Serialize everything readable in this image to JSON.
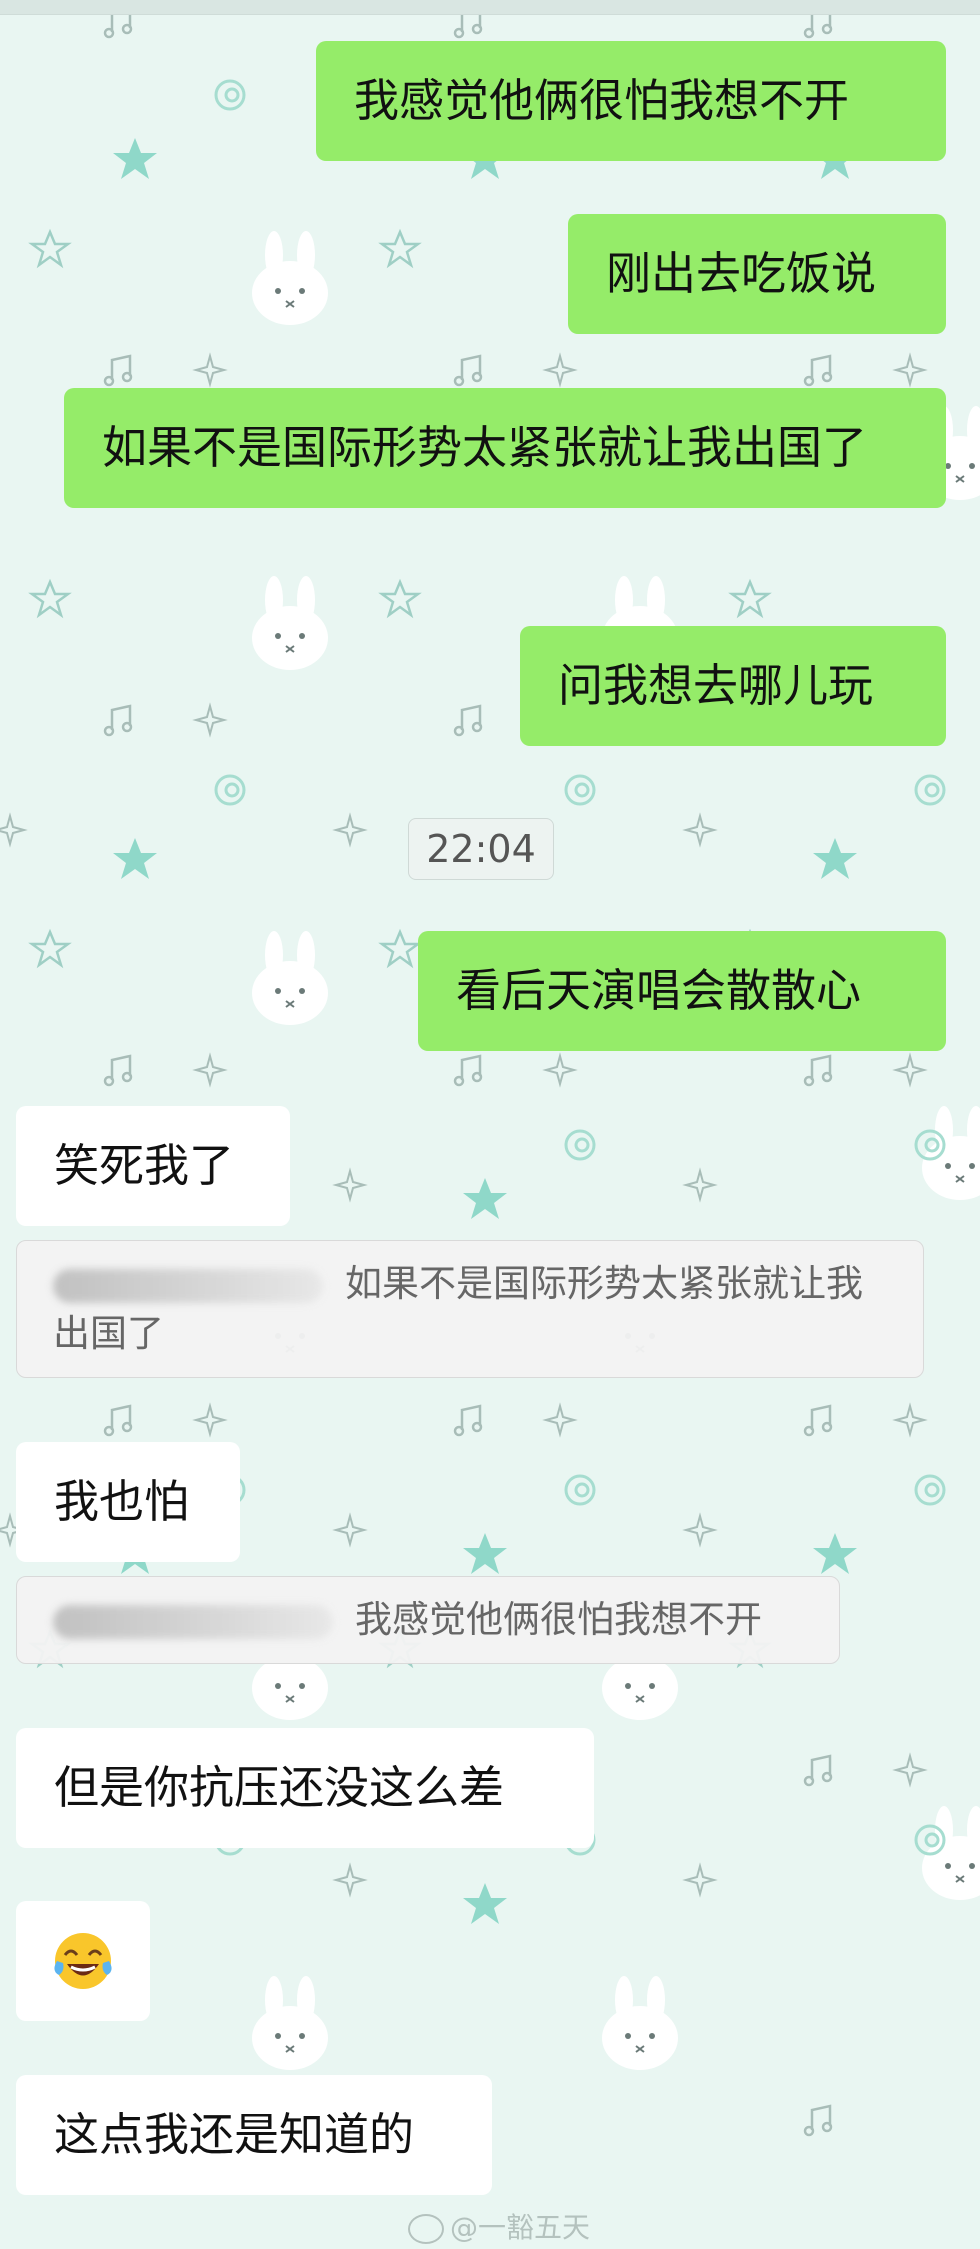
{
  "theme": {
    "outgoing_bubble_color": "#95ec69",
    "incoming_bubble_color": "#ffffff",
    "background_color": "#e9f6f2"
  },
  "messages": [
    {
      "side": "out",
      "text": "我感觉他俩很怕我想不开"
    },
    {
      "side": "out",
      "text": "刚出去吃饭说"
    },
    {
      "side": "out",
      "text": "如果不是国际形势太紧张就让我出国了"
    },
    {
      "side": "out",
      "text": "问我想去哪儿玩"
    },
    {
      "side": "out",
      "text": "看后天演唱会散散心"
    },
    {
      "side": "in",
      "text": "笑死我了"
    },
    {
      "side": "in",
      "text": "我也怕"
    },
    {
      "side": "in",
      "text": "但是你抗压还没这么差"
    },
    {
      "side": "in",
      "emoji": "tears-of-joy-emoji"
    },
    {
      "side": "in",
      "text": "这点我还是知道的"
    }
  ],
  "quotes": [
    {
      "text": "如果不是国际形势太紧张就让我出国了"
    },
    {
      "text": "我感觉他俩很怕我想不开"
    }
  ],
  "timestamp": "22:04",
  "watermark": "@一豁五天",
  "background_icons": [
    "bunny-icon",
    "star-icon",
    "music-note-icon",
    "sparkle-icon",
    "swirl-icon"
  ]
}
